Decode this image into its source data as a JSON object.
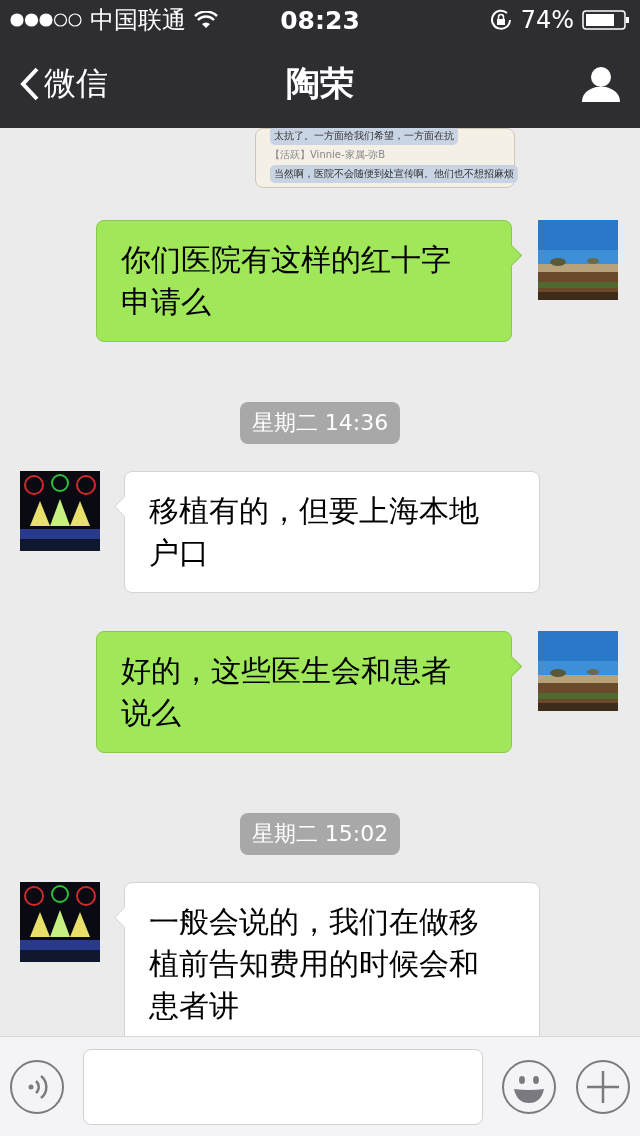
{
  "status_bar": {
    "carrier": "中国联通",
    "time": "08:23",
    "battery": "74%"
  },
  "nav": {
    "back": "微信",
    "title": "陶荣"
  },
  "messages": [
    {
      "lines": [
        {
          "kind": "bubble",
          "text": "太抗了。一方面给我们希望，一方面在抗"
        },
        {
          "kind": "sender",
          "text": "【活跃】Vinnie-家属-弥B"
        },
        {
          "kind": "bubble",
          "text": "当然啊，医院不会随便到处宣传啊。他们也不想招麻烦"
        }
      ]
    },
    {
      "kind": "sent",
      "text": "你们医院有这样的红十字申请么"
    },
    {
      "kind": "time",
      "text": "星期二 14:36"
    },
    {
      "kind": "received",
      "text": "移植有的，但要上海本地户口"
    },
    {
      "kind": "sent",
      "text": "好的，这些医生会和患者说么"
    },
    {
      "kind": "time",
      "text": "星期二 15:02"
    },
    {
      "kind": "received",
      "text": "一般会说的，我们在做移植前告知费用的时候会和患者讲"
    }
  ]
}
